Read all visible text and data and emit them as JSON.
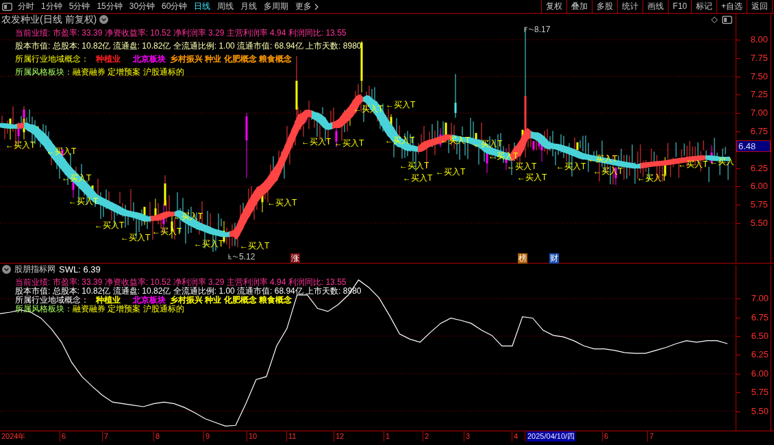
{
  "toolbar": {
    "periods": [
      {
        "label": "分时",
        "kind": "period",
        "selected": false
      },
      {
        "label": "1分钟",
        "kind": "period",
        "selected": false
      },
      {
        "label": "5分钟",
        "kind": "period",
        "selected": false
      },
      {
        "label": "15分钟",
        "kind": "period",
        "selected": false
      },
      {
        "label": "30分钟",
        "kind": "period",
        "selected": false
      },
      {
        "label": "60分钟",
        "kind": "period",
        "selected": false
      },
      {
        "label": "日线",
        "kind": "period",
        "selected": true
      },
      {
        "label": "周线",
        "kind": "period",
        "selected": false
      },
      {
        "label": "月线",
        "kind": "period",
        "selected": false
      },
      {
        "label": "多周期",
        "kind": "period",
        "selected": false
      },
      {
        "label": "更多",
        "kind": "menu",
        "selected": false
      }
    ],
    "actions": [
      "复权",
      "叠加",
      "多股",
      "统计",
      "画线",
      "F10",
      "标记",
      "+自选",
      "返回"
    ]
  },
  "price_panel": {
    "title": "农发种业(日线 前复权)",
    "info": {
      "performance": "当前业绩: 市盈率: 33.39 净资收益率: 10.52 净利润率 3.29 主营利润率 4.94 利润同比: 13.55",
      "capital": "股本市值: 总股本: 10.82亿 流通盘: 10.82亿 全流通比例: 1.00 流通市值: 68.94亿 上市天数: 8980",
      "industry_label": "所属行业地域概念：",
      "industry_tags": [
        {
          "label": "种植业",
          "color": "#ff2020"
        },
        {
          "label": "北京板块",
          "color": "#ff00ff"
        },
        {
          "label": "乡村振兴 种业 化肥概念 粮食概念",
          "color": "#ff9a00"
        }
      ],
      "style_label": "所属风格板块：",
      "style_tags": "融资融券 定增预案 沪股通标的"
    },
    "buy_signals": [
      "←买入T",
      "←买入T",
      "←买入T",
      "←买入T",
      "←买入T",
      "←买入T",
      "←买入T",
      "←买入T",
      "←买入T",
      "←买入T",
      "←买入T",
      "←买入T",
      "←买入T",
      "←买入T",
      "←买入T",
      "←买入T",
      "←买入T",
      "←买入T",
      "←买入T",
      "←买入T",
      "←买入T",
      "←买入T",
      "←买入T",
      "←买入T",
      "←买入T",
      "←买入T",
      "←买入T",
      "←买入T",
      "←买入T",
      "←买入"
    ],
    "high_marker": "8.17",
    "low_marker": "5.12",
    "event_tags": [
      {
        "label": "涨",
        "color": "#7a0a0a"
      },
      {
        "label": "榜",
        "color": "#b06000"
      },
      {
        "label": "财",
        "color": "#1e4fb0"
      }
    ],
    "price_axis": [
      "8.00",
      "7.75",
      "7.50",
      "7.25",
      "7.00",
      "6.75",
      "6.25",
      "6.00",
      "5.75",
      "5.50"
    ],
    "current_price": "6.48"
  },
  "indicator_panel": {
    "name": "股朋指标网",
    "reading": ": 6.39",
    "info": {
      "performance": "当前业绩: 市盈率: 33.39 净资收益率: 10.52 净利润率 3.29 主营利润率 4.94 利润同比: 13.55",
      "capital": "股本市值: 总股本: 10.82亿 流通盘: 10.82亿 全流通比例: 1.00 流通市值: 68.94亿 上市天数: 8980",
      "industry_label": "所属行业地域概念：",
      "industry_tags": [
        {
          "label": "种植业",
          "color": "#ffff00"
        },
        {
          "label": "北京板块",
          "color": "#ff00ff"
        },
        {
          "label": "乡村振兴 种业 化肥概念 粮食概念",
          "color": "#ffff00"
        }
      ],
      "style_label": "所属风格板块：",
      "style_tags": "融资融券 定增预案 沪股通标的"
    },
    "chart_data": {
      "type": "line",
      "grid": true,
      "ylim": [
        5.24,
        7.45
      ],
      "yticks": [
        {
          "value": 7,
          "label": "7.00"
        },
        {
          "value": 6.75,
          "label": "6.75"
        },
        {
          "value": 6.5,
          "label": "6.50"
        },
        {
          "value": 6.25,
          "label": "6.25"
        },
        {
          "value": 6,
          "label": "6.00"
        },
        {
          "value": 5.75,
          "label": "5.75"
        },
        {
          "value": 5.5,
          "label": "5.50"
        }
      ],
      "series": [
        {
          "name": "SWL",
          "color": "#ffffff",
          "values": [
            6.8,
            6.82,
            6.85,
            6.82,
            6.74,
            6.6,
            6.42,
            6.15,
            5.96,
            5.83,
            5.71,
            5.62,
            5.6,
            5.58,
            5.56,
            5.6,
            5.62,
            5.6,
            5.55,
            5.48,
            5.4,
            5.35,
            5.3,
            5.31,
            5.6,
            5.92,
            5.96,
            6.37,
            6.6,
            7.05,
            7.05,
            6.87,
            6.83,
            6.92,
            7.05,
            7.25,
            7.15,
            7.01,
            6.78,
            6.53,
            6.46,
            6.42,
            6.55,
            6.67,
            6.74,
            6.71,
            6.67,
            6.58,
            6.51,
            6.37,
            6.37,
            6.76,
            6.74,
            6.58,
            6.51,
            6.49,
            6.44,
            6.37,
            6.33,
            6.33,
            6.31,
            6.28,
            6.27,
            6.27,
            6.31,
            6.35,
            6.4,
            6.44,
            6.42,
            6.44,
            6.44,
            6.4
          ]
        }
      ]
    }
  },
  "date_axis": [
    {
      "label": "2024年",
      "selected": false
    },
    {
      "label": "6",
      "selected": false
    },
    {
      "label": "7",
      "selected": false
    },
    {
      "label": "8",
      "selected": false
    },
    {
      "label": "9",
      "selected": false
    },
    {
      "label": "10",
      "selected": false
    },
    {
      "label": "11",
      "selected": false
    },
    {
      "label": "12",
      "selected": false
    },
    {
      "label": "1",
      "selected": false
    },
    {
      "label": "2",
      "selected": false
    },
    {
      "label": "3",
      "selected": false
    },
    {
      "label": "4",
      "selected": false
    },
    {
      "label": "2025/04/10/四",
      "selected": true
    },
    {
      "label": "6",
      "selected": false
    },
    {
      "label": "7",
      "selected": false
    }
  ]
}
